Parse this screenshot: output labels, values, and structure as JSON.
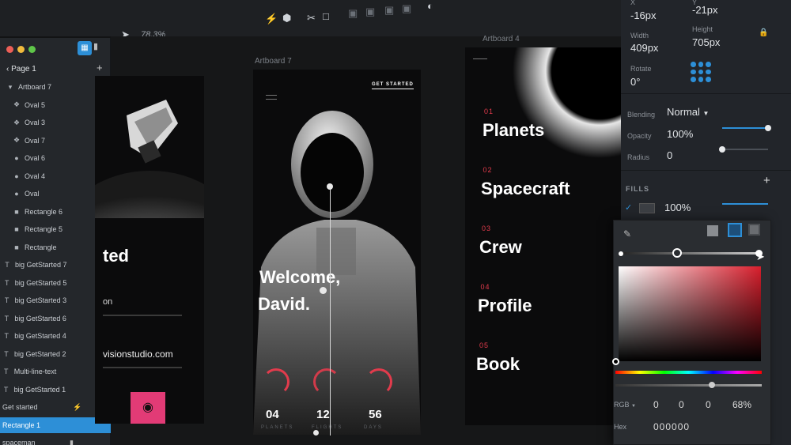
{
  "toolbar": {
    "zoom": "78.3%"
  },
  "left_panel": {
    "page": "Page 1",
    "layers": [
      {
        "name": "Artboard 7",
        "icon": "triangle-down-icon"
      },
      {
        "name": "Oval 5",
        "icon": "shape-icon"
      },
      {
        "name": "Oval 3",
        "icon": "shape-icon"
      },
      {
        "name": "Oval 7",
        "icon": "shape-icon"
      },
      {
        "name": "Oval 6",
        "icon": "circle-icon"
      },
      {
        "name": "Oval 4",
        "icon": "circle-icon"
      },
      {
        "name": "Oval",
        "icon": "circle-icon"
      },
      {
        "name": "Rectangle 6",
        "icon": "square-icon"
      },
      {
        "name": "Rectangle 5",
        "icon": "square-icon"
      },
      {
        "name": "Rectangle",
        "icon": "square-icon"
      },
      {
        "name": "big GetStarted 7",
        "icon": "text-icon"
      },
      {
        "name": "big GetStarted 5",
        "icon": "text-icon"
      },
      {
        "name": "big GetStarted 3",
        "icon": "text-icon"
      },
      {
        "name": "big GetStarted 6",
        "icon": "text-icon"
      },
      {
        "name": "big GetStarted 4",
        "icon": "text-icon"
      },
      {
        "name": "big GetStarted 2",
        "icon": "text-icon"
      },
      {
        "name": "Multi-line-text",
        "icon": "text-icon"
      },
      {
        "name": "big GetStarted 1",
        "icon": "text-icon"
      },
      {
        "name": "Get started",
        "icon": "lightning-icon"
      },
      {
        "name": "Rectangle 1",
        "icon": "none"
      },
      {
        "name": "spaceman",
        "icon": "lock-icon"
      }
    ]
  },
  "artboards": {
    "left": {
      "partial_word": "ted",
      "small_text": "on",
      "url_text": "visionstudio.com"
    },
    "center": {
      "label": "Artboard 7",
      "cta": "GET STARTED",
      "welcome_line1": "Welcome,",
      "welcome_line2": "David.",
      "stats": [
        {
          "value": "04",
          "label": "PLANETS"
        },
        {
          "value": "12",
          "label": "FLIGHTS"
        },
        {
          "value": "56",
          "label": "DAYS"
        }
      ]
    },
    "right": {
      "label": "Artboard 4",
      "menu": [
        {
          "num": "01",
          "label": "Planets"
        },
        {
          "num": "02",
          "label": "Spacecraft"
        },
        {
          "num": "03",
          "label": "Crew"
        },
        {
          "num": "04",
          "label": "Profile"
        },
        {
          "num": "05",
          "label": "Book"
        }
      ]
    }
  },
  "inspector": {
    "x_label": "X",
    "x_value": "-16px",
    "y_label": "Y",
    "y_value": "-21px",
    "width_label": "Width",
    "width_value": "409px",
    "height_label": "Height",
    "height_value": "705px",
    "rotate_label": "Rotate",
    "rotate_value": "0°",
    "blending_label": "Blending",
    "blending_value": "Normal",
    "opacity_label": "Opacity",
    "opacity_value": "100%",
    "opacity_level": 1.0,
    "radius_label": "Radius",
    "radius_value": "0",
    "radius_level": 0.0,
    "fills_label": "FILLS",
    "fill_opacity": "100%",
    "color": {
      "mode": "RGB",
      "r": "0",
      "g": "0",
      "b": "0",
      "a": "68%",
      "hex_label": "Hex",
      "hex": "000000"
    }
  },
  "colors": {
    "accent": "#2d8fd7",
    "brand_red": "#e23b4c",
    "selection": "#2d8fd7"
  }
}
